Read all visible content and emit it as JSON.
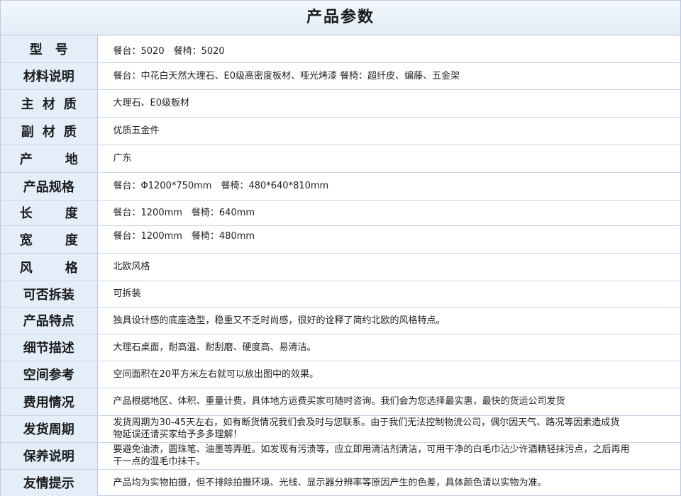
{
  "header": {
    "title": "产品参数"
  },
  "rows": [
    {
      "label": "型　号",
      "value": "餐台：5020　餐椅：5020"
    },
    {
      "label": "材料说明",
      "value": "餐台：中花白天然大理石、E0级高密度板材、哑光烤漆 餐椅：超纤皮、编藤、五金架"
    },
    {
      "label": "主材质",
      "value": "大理石、E0级板材"
    },
    {
      "label": "副材质",
      "value": "优质五金件"
    },
    {
      "label": "产　地",
      "value": "广东"
    },
    {
      "label": "产品规格",
      "value": "餐台：Φ1200*750mm　餐椅：480*640*810mm"
    },
    {
      "label": "长　度",
      "value": "餐台：1200mm　餐椅：640mm"
    },
    {
      "label": "宽　度",
      "value": "餐台：1200mm　餐椅：480mm"
    },
    {
      "label": "风　格",
      "value": "北欧风格"
    },
    {
      "label": "可否拆装",
      "value": "可拆装"
    },
    {
      "label": "产品特点",
      "value": "独具设计感的底座造型，稳重又不乏时尚感，很好的诠释了简约北欧的风格特点。"
    },
    {
      "label": "细节描述",
      "value": "大理石桌面，耐高温、耐刮磨、硬度高、易清洁。"
    },
    {
      "label": "空间参考",
      "value": "空间面积在20平方米左右就可以放出图中的效果。"
    },
    {
      "label": "费用情况",
      "value": "产品根据地区、体积、重量计费，具体地方运费买家可随时咨询。我们会为您选择最实惠，最快的货运公司发货"
    },
    {
      "label": "发货周期",
      "value": "发货周期为30-45天左右，如有断货情况我们会及时与您联系。由于我们无法控制物流公司，偶尔因天气、路况等因素造成货物延误还请买家给予多多理解！"
    },
    {
      "label": "保养说明",
      "value": "要避免油渍，圆珠笔、油墨等弄脏。如发现有污渍等，应立即用清洁剂清洁，可用干净的白毛巾沾少许酒精轻抹污点，之后再用干一点的湿毛巾抹干。"
    },
    {
      "label": "友情提示",
      "value": "产品均为实物拍摄，但不排除拍摄环境、光线、显示器分辨率等原因产生的色差，具体颜色请以实物为准。"
    }
  ]
}
